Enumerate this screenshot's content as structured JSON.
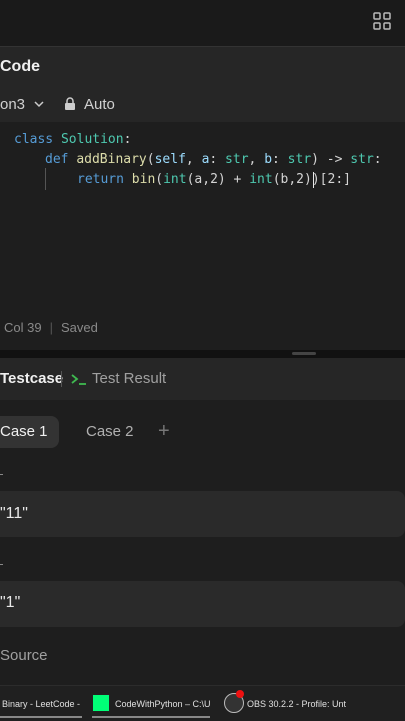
{
  "editor": {
    "title": "Code",
    "language": "on3",
    "lock_label": "Auto",
    "code": {
      "line1": {
        "kw": "class",
        "name": "Solution",
        "colon": ":"
      },
      "line2": {
        "kw": "def",
        "fn": "addBinary",
        "open": "(",
        "self": "self",
        "a": "a",
        "sep1": ": ",
        "str1": "str",
        "comma": ", ",
        "b": "b",
        "sep2": ": ",
        "str2": "str",
        "rest": ") -> ",
        "str3": "str",
        "end": ":"
      },
      "line3": {
        "kw": "return",
        "bin": "bin",
        "p1": "(",
        "int1": "int",
        "args1": "(a,2) + ",
        "int2": "int",
        "args2": "(b,2)",
        "p2": ")",
        "slice": "[2:]"
      }
    },
    "status": {
      "position": "Col 39",
      "saved": "Saved"
    }
  },
  "testpanel": {
    "tabs": {
      "testcase": "Testcase",
      "result": "Test Result"
    },
    "cases": [
      "Case 1",
      "Case 2"
    ],
    "add": "+",
    "inputs": [
      "\"11\"",
      "\"1\""
    ],
    "source": "Source"
  },
  "taskbar": {
    "items": [
      "Binary - LeetCode -",
      "CodeWithPython – C:\\U",
      "OBS 30.2.2 - Profile: Unt"
    ]
  },
  "icons": {
    "grid": "grid-icon",
    "chevron": "chevron-down-icon",
    "lock": "lock-icon",
    "terminal": "terminal-icon"
  }
}
